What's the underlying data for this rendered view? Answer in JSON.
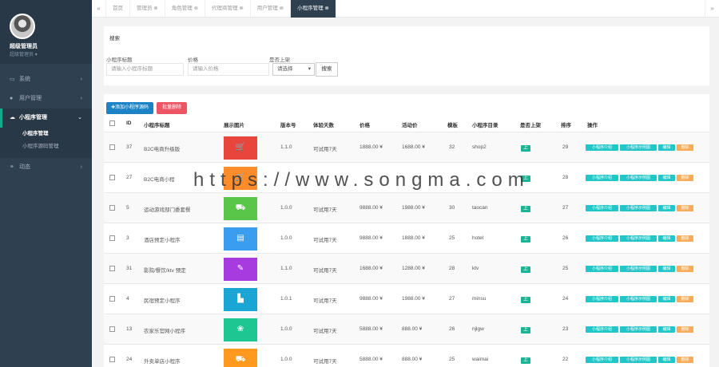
{
  "sidebar": {
    "profile_name": "超级管理员",
    "profile_role": "超级管理员",
    "nav": [
      {
        "label": "系统",
        "icon": "monitor-icon"
      },
      {
        "label": "用户管理",
        "icon": "user-icon"
      },
      {
        "label": "小程序管理",
        "icon": "chat-icon",
        "active": true
      },
      {
        "label": "动态",
        "icon": "share-icon"
      }
    ],
    "sub": [
      "小程序管理",
      "小程序源码管理"
    ]
  },
  "tabbar": {
    "prev": "«",
    "next": "»",
    "tabs": [
      "首页 ",
      "管理员 ⊗",
      "角色管理 ⊗",
      "代理商管理 ⊗",
      "用户管理 ⊗",
      "小程序管理 ⊗"
    ]
  },
  "search": {
    "title": "搜索",
    "title_label": "小程序标题",
    "title_placeholder": "请输入小程序标题",
    "price_label": "价格",
    "price_placeholder": "请输入价格",
    "publish_label": "是否上架",
    "publish_value": "请选择",
    "button": "搜索"
  },
  "toolbar": {
    "add": "✚添加小程序源码",
    "delete": "批量删除"
  },
  "table": {
    "headers": [
      "ID",
      "小程序标题",
      "展示图片",
      "版本号",
      "体验天数",
      "价格",
      "活动价",
      "模板",
      "小程序目录",
      "是否上架",
      "排序",
      "操作"
    ],
    "publish_label": "上",
    "actions": [
      "小程序介绍",
      "小程序示例图",
      "编辑",
      "删除"
    ],
    "rows": [
      {
        "id": "37",
        "title": "B2C电商升级版",
        "version": "1.1.0",
        "trial": "可试用7天",
        "price": "1888.00 ¥",
        "sale": "1688.00 ¥",
        "tpl": "32",
        "dir": "shop2",
        "sort": "29",
        "color": "#e8453c",
        "icon": "cart-icon"
      },
      {
        "id": "27",
        "title": "B2C电商小程",
        "version": "",
        "trial": "",
        "price": "",
        "sale": "",
        "tpl": "",
        "dir": "",
        "sort": "28",
        "color": "#ff8c2b",
        "icon": "cart-icon"
      },
      {
        "id": "5",
        "title": "运动游戏部门委套餐",
        "version": "1.0.0",
        "trial": "可试用7天",
        "price": "9888.00 ¥",
        "sale": "1988.00 ¥",
        "tpl": "30",
        "dir": "taocan",
        "sort": "27",
        "color": "#59c64a",
        "icon": "bag-icon"
      },
      {
        "id": "3",
        "title": "酒店预定小程序",
        "version": "1.0.0",
        "trial": "可试用7天",
        "price": "9888.00 ¥",
        "sale": "1888.00 ¥",
        "tpl": "25",
        "dir": "hotel",
        "sort": "26",
        "color": "#3b9df0",
        "icon": "doc-icon"
      },
      {
        "id": "31",
        "title": "影院/餐饮/ktv 预定",
        "version": "1.1.0",
        "trial": "可试用7天",
        "price": "1688.00 ¥",
        "sale": "1288.00 ¥",
        "tpl": "28",
        "dir": "ktv",
        "sort": "25",
        "color": "#a83be0",
        "icon": "mic-icon"
      },
      {
        "id": "4",
        "title": "民宿预定小程序",
        "version": "1.0.1",
        "trial": "可试用7天",
        "price": "9888.00 ¥",
        "sale": "1988.00 ¥",
        "tpl": "27",
        "dir": "minsu",
        "sort": "24",
        "color": "#1ba5d4",
        "icon": "building-icon"
      },
      {
        "id": "13",
        "title": "农家乐官网小程序",
        "version": "1.0.0",
        "trial": "可试用7天",
        "price": "5888.00 ¥",
        "sale": "888.00 ¥",
        "tpl": "26",
        "dir": "njlgw",
        "sort": "23",
        "color": "#1ec792",
        "icon": "leaf-icon"
      },
      {
        "id": "24",
        "title": "外卖单店小程序",
        "version": "1.0.0",
        "trial": "可试用7天",
        "price": "5888.00 ¥",
        "sale": "888.00 ¥",
        "tpl": "25",
        "dir": "waimai",
        "sort": "22",
        "color": "#ff9a1f",
        "icon": "bag-icon"
      }
    ]
  },
  "watermark": "https://www.songma.com"
}
